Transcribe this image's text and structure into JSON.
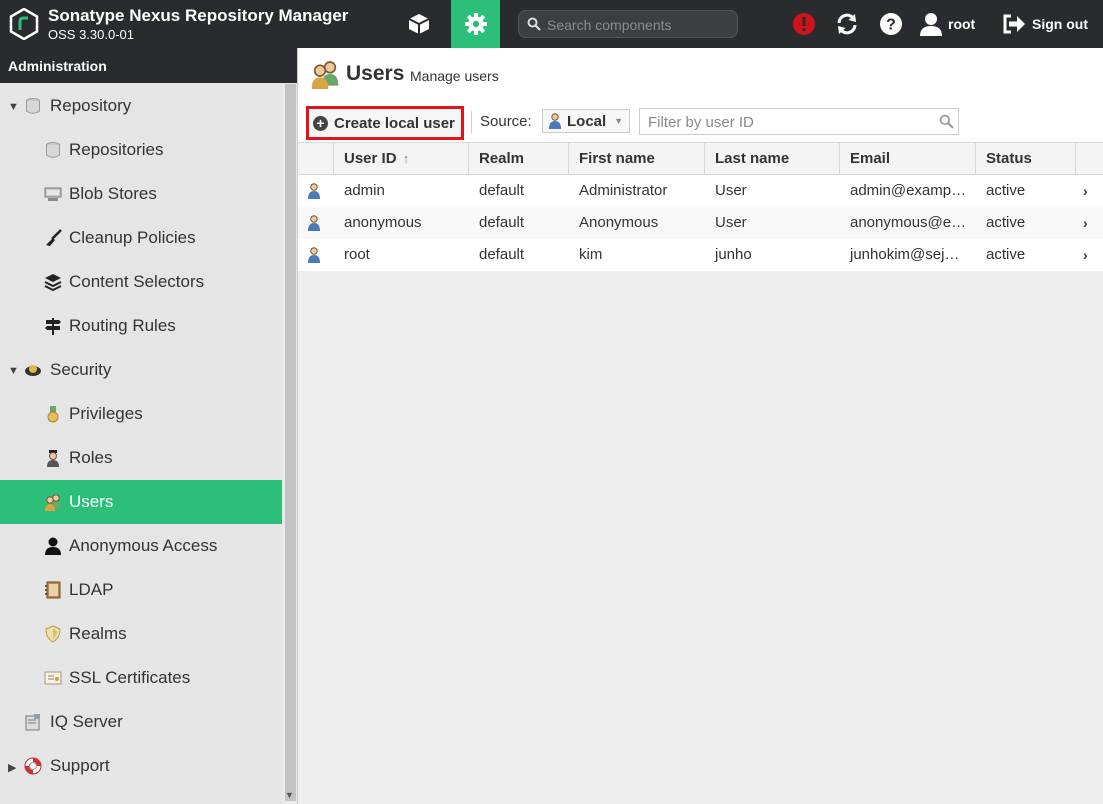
{
  "app": {
    "title": "Sonatype Nexus Repository Manager",
    "version": "OSS 3.30.0-01",
    "search_placeholder": "Search components",
    "user": "root",
    "sign_out": "Sign out",
    "icons": {
      "logo": "nexus-logo-icon",
      "browse": "cube-icon",
      "admin": "gear-icon",
      "search": "search-icon",
      "alert": "exclamation-icon",
      "refresh": "refresh-icon",
      "help": "help-icon",
      "user": "user-icon",
      "signout": "sign-out-icon"
    },
    "colors": {
      "topbar": "#2a2b2e",
      "accent": "#2bbf7a",
      "highlight": "#e3121b",
      "alert": "#d0121b"
    }
  },
  "sidebar": {
    "header": "Administration",
    "items": [
      {
        "label": "Repository",
        "level": 1,
        "caret": "▼",
        "icon": "database-icon"
      },
      {
        "label": "Repositories",
        "level": 2,
        "icon": "database-icon"
      },
      {
        "label": "Blob Stores",
        "level": 2,
        "icon": "server-icon"
      },
      {
        "label": "Cleanup Policies",
        "level": 2,
        "icon": "broom-icon"
      },
      {
        "label": "Content Selectors",
        "level": 2,
        "icon": "layers-icon"
      },
      {
        "label": "Routing Rules",
        "level": 2,
        "icon": "signpost-icon"
      },
      {
        "label": "Security",
        "level": 1,
        "caret": "▼",
        "icon": "security-badge-icon"
      },
      {
        "label": "Privileges",
        "level": 2,
        "icon": "medal-icon"
      },
      {
        "label": "Roles",
        "level": 2,
        "icon": "role-person-icon"
      },
      {
        "label": "Users",
        "level": 2,
        "icon": "users-icon",
        "selected": true
      },
      {
        "label": "Anonymous Access",
        "level": 2,
        "icon": "person-silhouette-icon"
      },
      {
        "label": "LDAP",
        "level": 2,
        "icon": "address-book-icon"
      },
      {
        "label": "Realms",
        "level": 2,
        "icon": "shield-icon"
      },
      {
        "label": "SSL Certificates",
        "level": 2,
        "icon": "certificate-icon"
      },
      {
        "label": "IQ Server",
        "level": 1,
        "icon": "iq-server-icon"
      },
      {
        "label": "Support",
        "level": 1,
        "caret": "▶",
        "icon": "lifebuoy-icon"
      }
    ]
  },
  "main": {
    "title": "Users",
    "subtitle": "Manage users",
    "create_button": "Create local user",
    "source_label": "Source:",
    "source_value": "Local",
    "filter_placeholder": "Filter by user ID",
    "columns": [
      "User ID",
      "Realm",
      "First name",
      "Last name",
      "Email",
      "Status"
    ],
    "sort_indicator": "↑",
    "rows": [
      {
        "user_id": "admin",
        "realm": "default",
        "first_name": "Administrator",
        "last_name": "User",
        "email": "admin@examp…",
        "status": "active"
      },
      {
        "user_id": "anonymous",
        "realm": "default",
        "first_name": "Anonymous",
        "last_name": "User",
        "email": "anonymous@e…",
        "status": "active"
      },
      {
        "user_id": "root",
        "realm": "default",
        "first_name": "kim",
        "last_name": "junho",
        "email": "junhokim@sej…",
        "status": "active"
      }
    ]
  }
}
